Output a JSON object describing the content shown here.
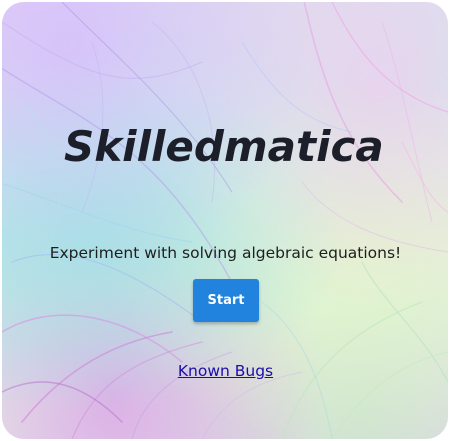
{
  "app": {
    "title": "Skilledmatica",
    "tagline": "Experiment with solving algebraic equations!"
  },
  "actions": {
    "start_label": "Start",
    "known_bugs_label": "Known Bugs"
  },
  "colors": {
    "start_button": "#2183de",
    "link": "#1a0dab",
    "title": "#1c1f29"
  }
}
